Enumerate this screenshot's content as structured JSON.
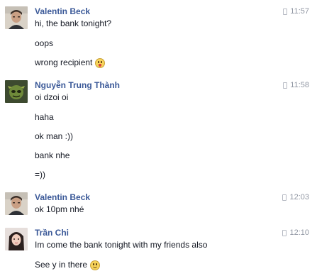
{
  "messages": [
    {
      "sender": "Valentin Beck",
      "time": "11:57",
      "avatar": "valentin-avatar",
      "lines": [
        "hi, the bank tonight?",
        "oops",
        "wrong recipient"
      ],
      "line_emoji": [
        "",
        "",
        "tongue-emoji"
      ]
    },
    {
      "sender": "Nguyễn Trung Thành",
      "time": "11:58",
      "avatar": "thanh-avatar",
      "lines": [
        "oi dzoi oi",
        "haha",
        "ok man :))",
        "bank nhe",
        "=))"
      ]
    },
    {
      "sender": "Valentin Beck",
      "time": "12:03",
      "avatar": "valentin-avatar",
      "lines": [
        "ok 10pm nhé"
      ]
    },
    {
      "sender": "Trần Chi",
      "time": "12:10",
      "avatar": "chi-avatar",
      "lines": [
        "Im come the bank tonight with my friends also",
        "See y in there"
      ],
      "line_emoji": [
        "",
        "smile-emoji"
      ]
    }
  ],
  "colors": {
    "name": "#3b5998",
    "time": "#9197a3",
    "text": "#141823"
  },
  "icons": {
    "timestamp": "mobile-phone-icon"
  }
}
